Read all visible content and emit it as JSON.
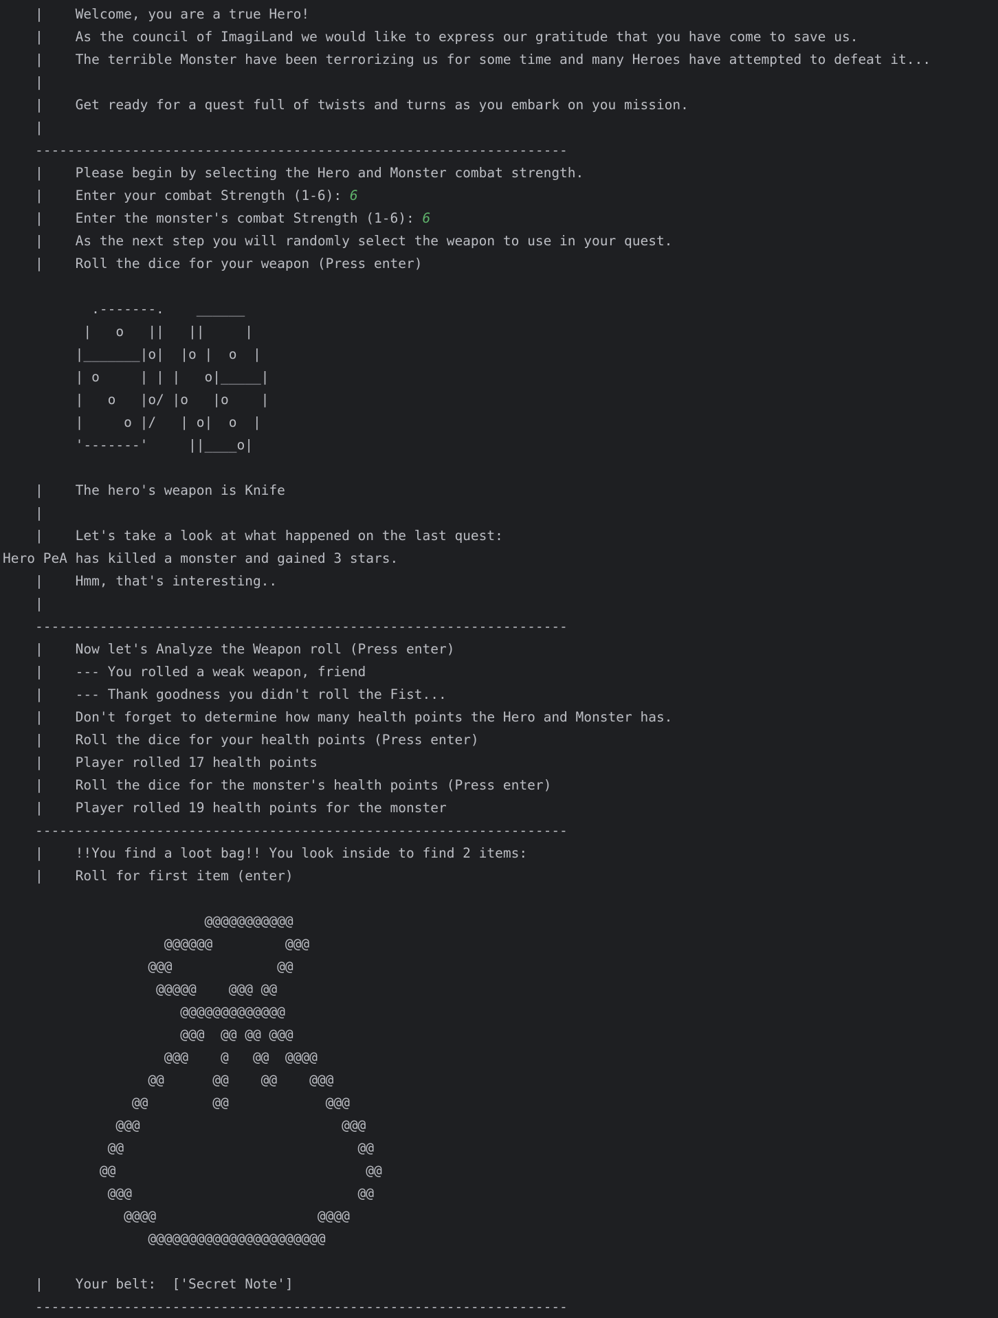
{
  "console": {
    "lines": [
      {
        "text": "    |    Welcome, you are a true Hero!"
      },
      {
        "text": "    |    As the council of ImagiLand we would like to express our gratitude that you have come to save us."
      },
      {
        "text": "    |    The terrible Monster have been terrorizing us for some time and many Heroes have attempted to defeat it..."
      },
      {
        "text": "    |"
      },
      {
        "text": "    |    Get ready for a quest full of twists and turns as you embark on you mission."
      },
      {
        "text": "    |"
      },
      {
        "text": "    ------------------------------------------------------------------"
      },
      {
        "text": "    |    Please begin by selecting the Hero and Monster combat strength."
      },
      {
        "text": "    |    Enter your combat Strength (1-6): ",
        "input": "6"
      },
      {
        "text": "    |    Enter the monster's combat Strength (1-6): ",
        "input": "6"
      },
      {
        "text": "    |    As the next step you will randomly select the weapon to use in your quest."
      },
      {
        "text": "    |    Roll the dice for your weapon (Press enter)"
      },
      {
        "text": ""
      },
      {
        "text": "           .-------.    ______"
      },
      {
        "text": "          |   o   ||   ||     |"
      },
      {
        "text": "         |_______|o|  |o |  o  |"
      },
      {
        "text": "         | o     | | |   o|_____|"
      },
      {
        "text": "         |   o   |o/ |o   |o    |"
      },
      {
        "text": "         |     o |/   | o|  o  |"
      },
      {
        "text": "         '-------'     ||____o|"
      },
      {
        "text": ""
      },
      {
        "text": "    |    The hero's weapon is Knife"
      },
      {
        "text": "    |"
      },
      {
        "text": "    |    Let's take a look at what happened on the last quest:"
      },
      {
        "text": "Hero PeA has killed a monster and gained 3 stars."
      },
      {
        "text": "    |    Hmm, that's interesting.."
      },
      {
        "text": "    |"
      },
      {
        "text": "    ------------------------------------------------------------------"
      },
      {
        "text": "    |    Now let's Analyze the Weapon roll (Press enter)"
      },
      {
        "text": "    |    --- You rolled a weak weapon, friend"
      },
      {
        "text": "    |    --- Thank goodness you didn't roll the Fist..."
      },
      {
        "text": "    |    Don't forget to determine how many health points the Hero and Monster has."
      },
      {
        "text": "    |    Roll the dice for your health points (Press enter)"
      },
      {
        "text": "    |    Player rolled 17 health points"
      },
      {
        "text": "    |    Roll the dice for the monster's health points (Press enter)"
      },
      {
        "text": "    |    Player rolled 19 health points for the monster"
      },
      {
        "text": "    ------------------------------------------------------------------"
      },
      {
        "text": "    |    !!You find a loot bag!! You look inside to find 2 items:"
      },
      {
        "text": "    |    Roll for first item (enter)"
      },
      {
        "text": ""
      },
      {
        "text": "                         @@@@@@@@@@@"
      },
      {
        "text": "                    @@@@@@         @@@"
      },
      {
        "text": "                  @@@             @@"
      },
      {
        "text": "                   @@@@@    @@@ @@"
      },
      {
        "text": "                      @@@@@@@@@@@@@"
      },
      {
        "text": "                      @@@  @@ @@ @@@"
      },
      {
        "text": "                    @@@    @   @@  @@@@"
      },
      {
        "text": "                  @@      @@    @@    @@@"
      },
      {
        "text": "                @@        @@            @@@"
      },
      {
        "text": "              @@@                         @@@"
      },
      {
        "text": "             @@                             @@"
      },
      {
        "text": "            @@                               @@"
      },
      {
        "text": "             @@@                            @@"
      },
      {
        "text": "               @@@@                    @@@@"
      },
      {
        "text": "                  @@@@@@@@@@@@@@@@@@@@@@"
      },
      {
        "text": ""
      },
      {
        "text": "    |    Your belt:  ['Secret Note']"
      },
      {
        "text": "    ------------------------------------------------------------------"
      }
    ]
  },
  "colors": {
    "background": "#1e1f22",
    "text": "#bcbec4",
    "user_input": "#5fb36b"
  }
}
